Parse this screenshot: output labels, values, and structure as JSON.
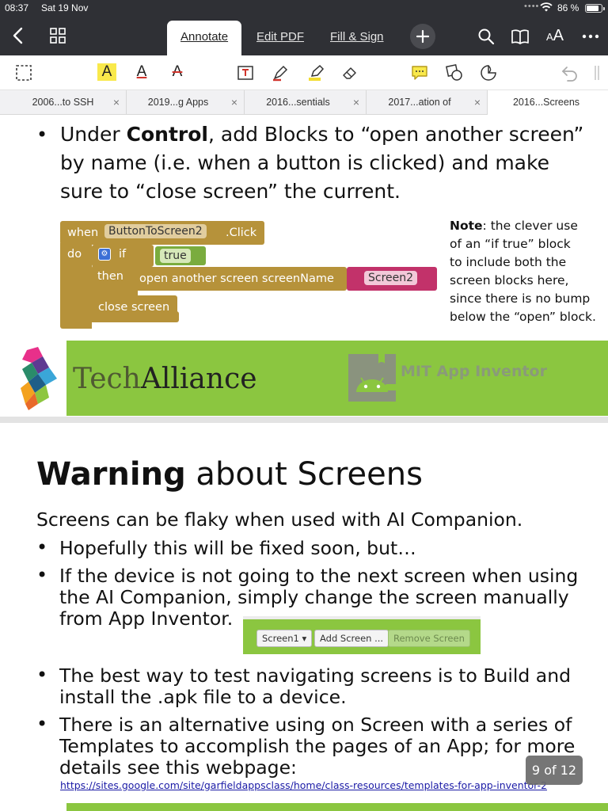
{
  "status": {
    "time": "08:37",
    "date": "Sat 19 Nov",
    "battery": "86 %",
    "battery_level": 0.86
  },
  "nav": {
    "tabs": [
      {
        "label": "Annotate",
        "active": true
      },
      {
        "label": "Edit PDF",
        "active": false
      },
      {
        "label": "Fill & Sign",
        "active": false
      }
    ],
    "aa_label": "A",
    "aa_big": "A"
  },
  "toolbar": {
    "highlight_letter": "A",
    "underline_letter": "A",
    "strike_letter": "A"
  },
  "doc_tabs": [
    {
      "label": "2006...to SSH",
      "active": false
    },
    {
      "label": "2019...g Apps",
      "active": false
    },
    {
      "label": "2016...sentials",
      "active": false
    },
    {
      "label": "2017...ation of",
      "active": false
    },
    {
      "label": "2016...Screens",
      "active": true
    }
  ],
  "page1": {
    "bullet_line1_pre": "Under ",
    "bullet_line1_bold": "Control",
    "bullet_line1_post": ", add Blocks to “open another screen”",
    "bullet_line2": "by name (i.e. when a button is clicked) and make",
    "bullet_line3": "sure to “close screen” the current.",
    "blocks": {
      "when": "when",
      "component": "ButtonToScreen2",
      "event": ".Click",
      "do": "do",
      "if": "if",
      "true": "true",
      "then": "then",
      "open_screen": "open another screen  screenName",
      "screen_name": "Screen2",
      "close_screen": "close screen"
    },
    "note_bold": "Note",
    "note_lines": [
      ": the clever use",
      "of an “if true” block",
      "to include both the",
      "screen blocks here,",
      "since there is no bump",
      "below the “open” block."
    ],
    "brand_tech": "Tech",
    "brand_alliance": "Alliance",
    "mit_text": "MIT App Inventor"
  },
  "page2": {
    "title_bold": "Warning",
    "title_rest": " about Screens",
    "intro": "Screens can be flaky when used with AI Companion.",
    "bullet1": "Hopefully this will be fixed soon, but…",
    "bullet2_lines": [
      "If the device is not going to the next screen when using",
      "the AI Companion, simply change the screen manually",
      "from App Inventor."
    ],
    "screen_buttons": [
      "Screen1 ▾",
      "Add Screen ...",
      "Remove Screen"
    ],
    "bullet3_lines": [
      "The best way to test navigating screens is to Build and",
      "install the .apk file to a device."
    ],
    "bullet4_lines": [
      "There is an alternative using on Screen with a series of",
      "Templates to accomplish the pages of an App; for more",
      "details see this webpage:"
    ],
    "link": "https://sites.google.com/site/garfieldappsclass/home/class-resources/templates-for-app-inventor-2"
  },
  "page_indicator": "9 of 12",
  "colors": {
    "chrome": "#2f3035",
    "green_band": "#8bc640",
    "block_gold": "#b6923a",
    "block_pink": "#c2326a",
    "block_green": "#7aac3e"
  }
}
